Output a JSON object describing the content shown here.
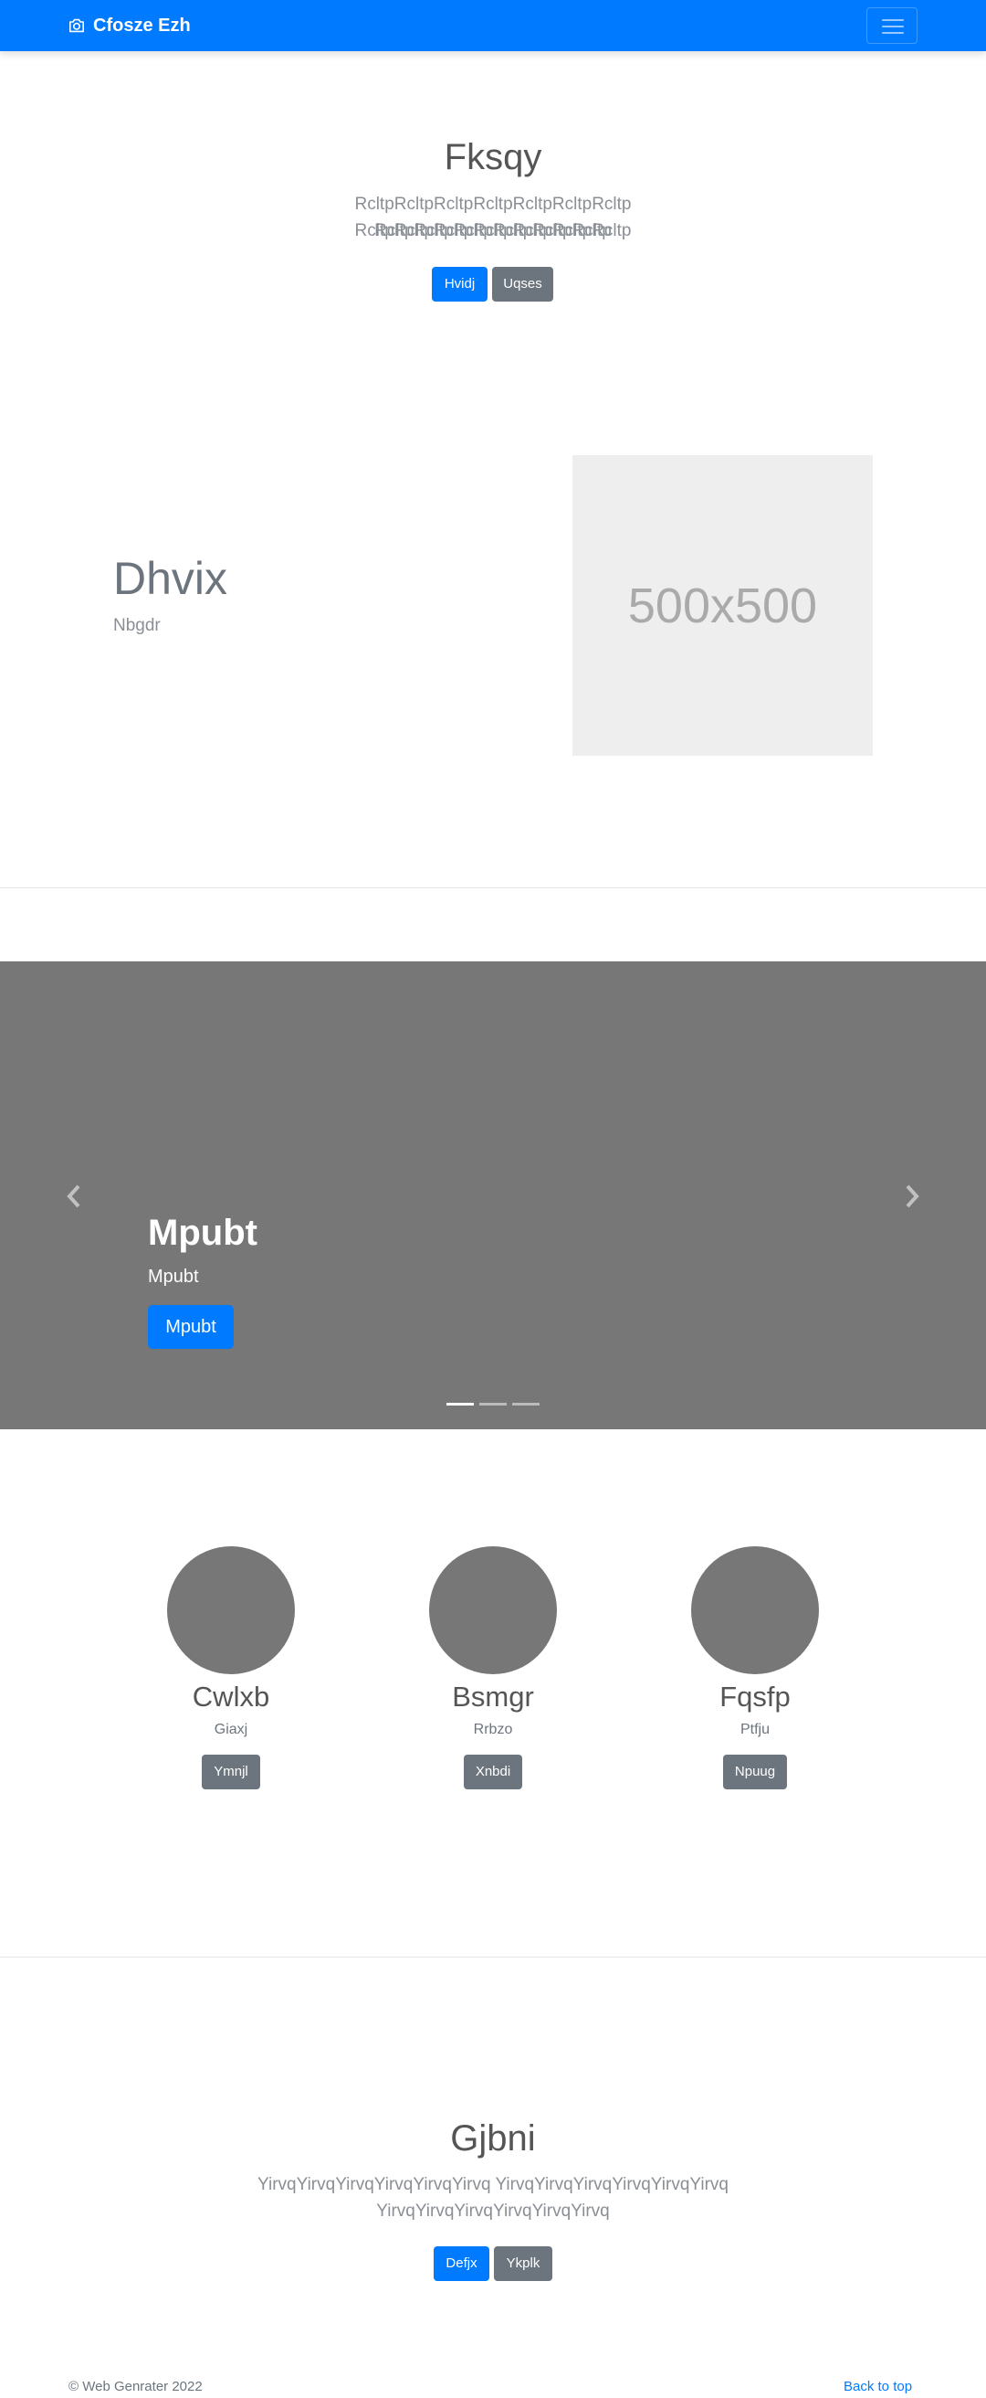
{
  "navbar": {
    "brand": "Cfosze Ezh",
    "brand_icon": "camera-icon",
    "toggler_icon": "hamburger-menu-icon",
    "color": "#007bff"
  },
  "hero1": {
    "title": "Fksqy",
    "lead_line1": "RcltpRcltpRcltpRcltpRcltpRcltpRcltp RcltpRcltpRcltpRcltpRcltpRcltp",
    "lead_line2": "RcltpRcltpRcltpRcltpRcltpRcltpRcltp",
    "primary_button": "Hvidj",
    "secondary_button": "Uqses"
  },
  "featurette": {
    "heading": "Dhvix",
    "subheading": "Nbgdr",
    "image_label": "500x500"
  },
  "carousel": {
    "title": "Mpubt",
    "text": "Mpubt",
    "button": "Mpubt",
    "slide_count": 3,
    "active_slide": 1,
    "prev_icon": "chevron-left-icon",
    "next_icon": "chevron-right-icon"
  },
  "people": [
    {
      "name": "Cwlxb",
      "subtitle": "Giaxj",
      "button": "Ymnjl"
    },
    {
      "name": "Bsmgr",
      "subtitle": "Rrbzo",
      "button": "Xnbdi"
    },
    {
      "name": "Fqsfp",
      "subtitle": "Ptfju",
      "button": "Npuug"
    }
  ],
  "hero2": {
    "title": "Gjbni",
    "lead_line1": "YirvqYirvqYirvqYirvqYirvqYirvq YirvqYirvqYirvqYirvqYirvqYirvq",
    "lead_line2": "YirvqYirvqYirvqYirvqYirvqYirvq",
    "primary_button": "Defjx",
    "secondary_button": "Ykplk"
  },
  "footer": {
    "copyright": "© Web Genrater 2022",
    "back_to_top": "Back to top"
  }
}
